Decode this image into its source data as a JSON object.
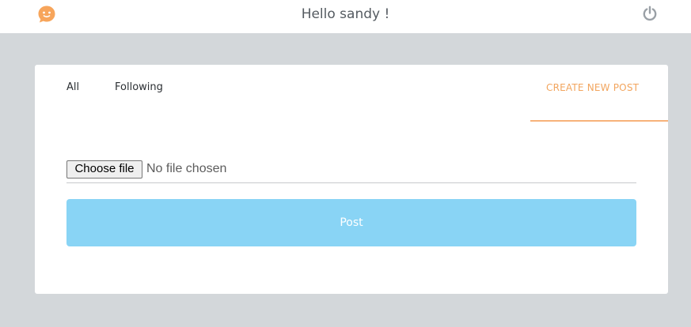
{
  "header": {
    "greeting": "Hello sandy !",
    "logo_icon": "smiley-chat-icon",
    "logout_icon": "power-icon",
    "brand_color": "#f7a55b"
  },
  "tabs": {
    "all": "All",
    "following": "Following",
    "create": "CREATE NEW POST",
    "active": "create"
  },
  "upload": {
    "button_label": "Choose file",
    "status_text": "No file chosen"
  },
  "post_button": {
    "label": "Post",
    "color": "#89d4f5"
  }
}
